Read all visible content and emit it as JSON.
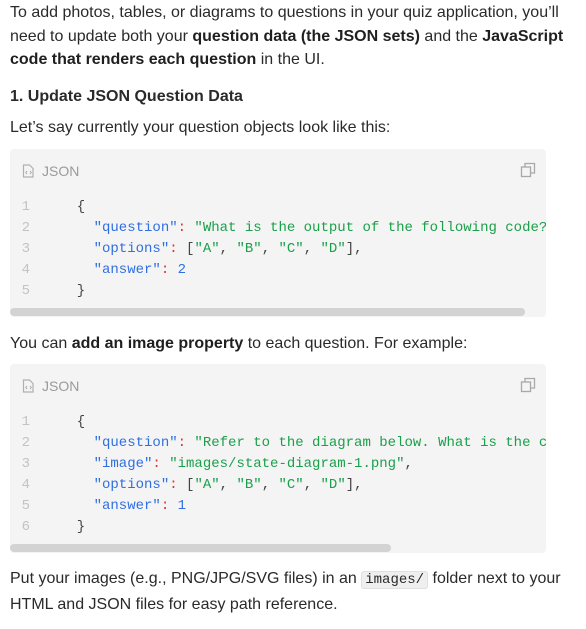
{
  "intro": {
    "t1": "To add photos, tables, or diagrams to questions in your quiz application, you’ll need to update both your ",
    "b1": "question data (the JSON sets)",
    "t2": " and the ",
    "b2": "JavaScript code that renders each question",
    "t3": " in the UI."
  },
  "heading": "1. Update JSON Question Data",
  "lead": "Let’s say currently your question objects look like this:",
  "middle": {
    "t1": "You can ",
    "b1": "add an image property",
    "t2": " to each question. For example:"
  },
  "closing": {
    "t1": "Put your images (e.g., PNG/JPG/SVG files) in an ",
    "code": "images/",
    "t2": " folder next to your HTML and JSON files for easy path reference."
  },
  "code_blocks": [
    {
      "language": "JSON",
      "icons": [
        "file-code-icon",
        "copy-icon"
      ],
      "scroll_fraction": 0.96,
      "lines": [
        [
          [
            "p",
            "  {"
          ]
        ],
        [
          [
            "k",
            "    \"question\""
          ],
          [
            "c",
            ":"
          ],
          [
            "s",
            " \"What is the output of the following code?\""
          ]
        ],
        [
          [
            "k",
            "    \"options\""
          ],
          [
            "c",
            ":"
          ],
          [
            "p",
            " ["
          ],
          [
            "s",
            "\"A\""
          ],
          [
            "p",
            ", "
          ],
          [
            "s",
            "\"B\""
          ],
          [
            "p",
            ", "
          ],
          [
            "s",
            "\"C\""
          ],
          [
            "p",
            ", "
          ],
          [
            "s",
            "\"D\""
          ],
          [
            "p",
            "],"
          ]
        ],
        [
          [
            "k",
            "    \"answer\""
          ],
          [
            "c",
            ":"
          ],
          [
            "n",
            " 2"
          ]
        ],
        [
          [
            "p",
            "  }"
          ]
        ]
      ]
    },
    {
      "language": "JSON",
      "icons": [
        "file-code-icon",
        "copy-icon"
      ],
      "scroll_fraction": 0.71,
      "lines": [
        [
          [
            "p",
            "  {"
          ]
        ],
        [
          [
            "k",
            "    \"question\""
          ],
          [
            "c",
            ":"
          ],
          [
            "s",
            " \"Refer to the diagram below. What is the correct next state?\","
          ]
        ],
        [
          [
            "k",
            "    \"image\""
          ],
          [
            "c",
            ":"
          ],
          [
            "s",
            " \"images/state-diagram-1.png\""
          ],
          [
            "p",
            ","
          ]
        ],
        [
          [
            "k",
            "    \"options\""
          ],
          [
            "c",
            ":"
          ],
          [
            "p",
            " ["
          ],
          [
            "s",
            "\"A\""
          ],
          [
            "p",
            ", "
          ],
          [
            "s",
            "\"B\""
          ],
          [
            "p",
            ", "
          ],
          [
            "s",
            "\"C\""
          ],
          [
            "p",
            ", "
          ],
          [
            "s",
            "\"D\""
          ],
          [
            "p",
            "],"
          ]
        ],
        [
          [
            "k",
            "    \"answer\""
          ],
          [
            "c",
            ":"
          ],
          [
            "n",
            " 1"
          ]
        ],
        [
          [
            "p",
            "  }"
          ]
        ]
      ]
    }
  ]
}
